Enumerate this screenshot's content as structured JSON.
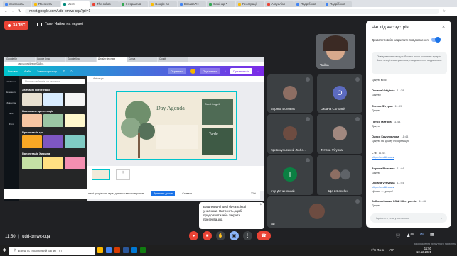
{
  "browser": {
    "tabs": [
      "поклоновь",
      "Презента",
      "The collab",
      "Інтерактив",
      "Google Кл",
      "Вправа \"Н",
      "Семінар \"",
      "Реєстрації",
      "Актуалізя",
      "Подрібнюв",
      "Подрібнюв"
    ],
    "active_tab": "Meet –",
    "url": "meet.google.com/udd-bmwc-cqa?pli=1"
  },
  "meet": {
    "recording_label": "ЗАПИС",
    "presenter_label": "Галя Чайка на екрані",
    "meeting_code": "udd-bmwc-cqa",
    "time": "11:50",
    "self_name": "Чайка",
    "bubble": {
      "text": "Ваш екран і досі бачать інші учасники. Натисніть, щоб продовжити або закрити презентацію."
    },
    "participants": [
      {
        "name": "Зоряна Воловик",
        "color": "#8d6e63",
        "initial": ""
      },
      {
        "name": "Оксана Соловей",
        "color": "#5c6bc0",
        "initial": "О"
      },
      {
        "name": "Кривокульський Любо…",
        "color": "#6d4c41",
        "initial": ""
      },
      {
        "name": "Тетяна Фігурка",
        "color": "#a1887f",
        "initial": ""
      },
      {
        "name": "Ігор Дячинський",
        "color": "#0b8043",
        "initial": "І"
      },
      {
        "name": "Ще 24 особи",
        "color": "#3c4043",
        "initial": ""
      },
      {
        "name": "Ви",
        "color": "#6d4c41",
        "initial": ""
      }
    ],
    "right_badge": "48"
  },
  "canva": {
    "tabs": [
      "Google Кл",
      "Google Клас",
      "Google Кла",
      "Дизайн без назв",
      "Canva",
      "Cloudfl"
    ],
    "url": "canva.com/design/DAEv...",
    "menu": [
      "Головна",
      "Файл",
      "Змінити розмір"
    ],
    "actions": [
      "Отримати",
      "Поділитися",
      "Презентація"
    ],
    "search_placeholder": "Пошук шаблонів за текстом",
    "sections": [
      "Звичайні презентації",
      "Навчальна презентація",
      "Презентація гри",
      "Презентація Хиршем"
    ],
    "rail": [
      "Шаблони",
      "Елементи",
      "Завантаж",
      "Текст",
      "Фото"
    ],
    "animate": "Анімація",
    "slide_title": "Day Agenda",
    "slide_side": "Don't forget!",
    "slide_todo": "To-do",
    "zoom": "32%",
    "sharing_text": "meet.google.com зараз ділиться вашим екраном.",
    "stop_sharing": "Зупинити доступ",
    "hide": "Сховати"
  },
  "chat": {
    "title": "Чат під час зустрічі",
    "allow_label": "Дозволити всім надсилати повідомлення",
    "notice": "Повідомлення можуть бачити лише учасники зустрічі. Коли зустріч завершиться, повідомлення видаляться.",
    "messages": [
      {
        "who": "Ви",
        "time": "11:38",
        "text": "Дякую всім"
      },
      {
        "who": "Оксана Vetlytska",
        "time": "11:38",
        "text": "Дякую!"
      },
      {
        "who": "Тетяна Фігурка",
        "time": "11:39",
        "text": "Дякую"
      },
      {
        "who": "Петро Матвіїв",
        "time": "11:44",
        "text": "Дякую"
      },
      {
        "who": "Олеся Кругляєлова",
        "time": "11:44",
        "text": "Дякую за цікаву інформацію"
      },
      {
        "who": "L G",
        "time": "11:44",
        "text": "https://reddit.com/"
      },
      {
        "who": "Зоряна Воловик",
        "time": "11:44",
        "text": "Дякую"
      },
      {
        "who": "Оксана Vetlytska",
        "time": "11:44",
        "text": "https://reddit.com/"
      },
      {
        "who": "",
        "time": "",
        "text": "Цікаво ... дякую!"
      },
      {
        "who": "Заболотівська ЗОШ І-ІІ ступенів",
        "time": "11:46",
        "text": "Дякую"
      }
    ],
    "input_placeholder": "Надішліть усім учасникам"
  },
  "taskbar": {
    "search_text": "Введіть пошуковий запит тут",
    "time": "11:50",
    "date": "10.12.2021",
    "temp": "1°C Ясно",
    "lang": "УКР",
    "record_toast": "Відображення присутності натисніть"
  },
  "colors": {
    "canva_gradient_start": "#00c4cc",
    "canva_gradient_end": "#7d2ae8",
    "end_call": "#ea4335",
    "link": "#1a73e8"
  }
}
